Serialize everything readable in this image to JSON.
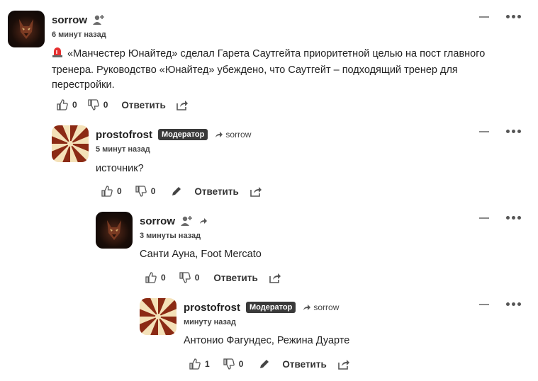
{
  "comments": [
    {
      "author": "sorrow",
      "time": "6 минут назад",
      "text_line1": "«Манчестер Юнайтед» сделал Гарета Саутгейта приоритетной целью на пост главного",
      "text_line2": "тренера. Руководство «Юнайтед» убеждено, что Саутгейт – подходящий тренер для",
      "text_line3": "перестройки.",
      "likes": "0",
      "dislikes": "0",
      "reply_label": "Ответить",
      "icons": [
        "siren-emoji",
        "add-user-icon",
        "thumbs-up-icon",
        "thumbs-down-icon",
        "share-icon",
        "collapse-icon",
        "more-icon"
      ]
    },
    {
      "author": "prostofrost",
      "badge": "Модератор",
      "reply_to": "sorrow",
      "time": "5 минут назад",
      "text": "источник?",
      "likes": "0",
      "dislikes": "0",
      "reply_label": "Ответить"
    },
    {
      "author": "sorrow",
      "time": "3 минуты назад",
      "text": "Санти Ауна, Foot Mercato",
      "likes": "0",
      "dislikes": "0",
      "reply_label": "Ответить"
    },
    {
      "author": "prostofrost",
      "badge": "Модератор",
      "reply_to": "sorrow",
      "time": "минуту назад",
      "text": "Антонио Фагундес, Режина Дуарте",
      "likes": "1",
      "dislikes": "0",
      "reply_label": "Ответить"
    }
  ],
  "colors": {
    "badge_bg": "#3a3a3a",
    "sunburst_a": "#8b2a14",
    "sunburst_b": "#f4e1b8"
  }
}
